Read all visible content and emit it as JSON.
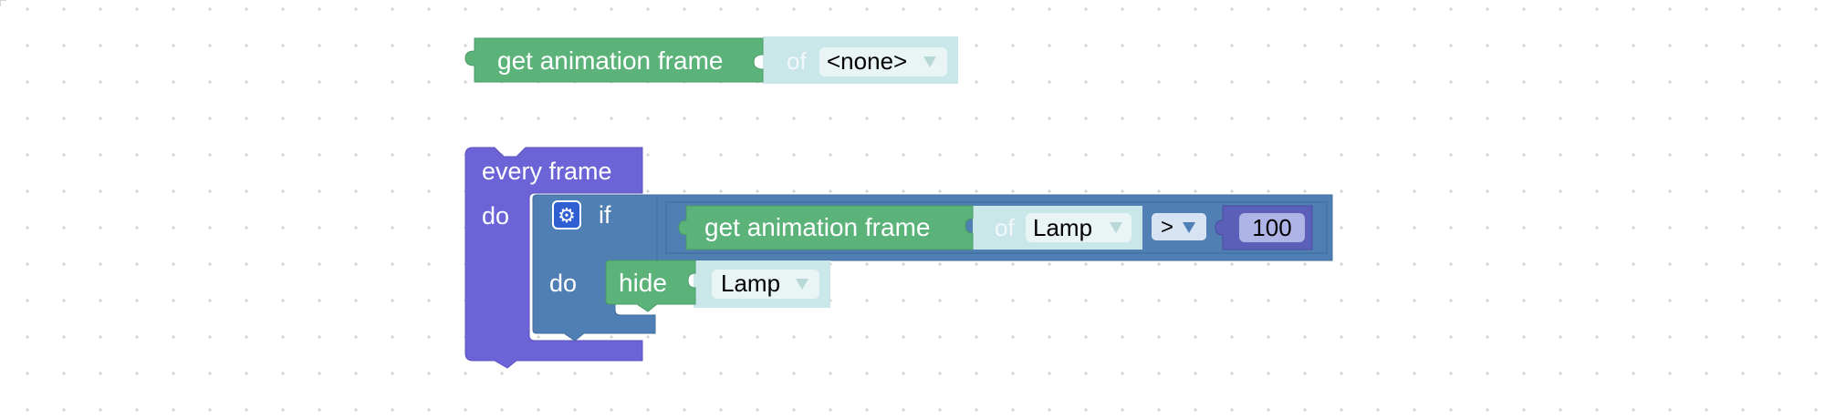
{
  "block_get_frame_1": {
    "label": "get animation frame",
    "of_label": "of",
    "object_value": "<none>"
  },
  "block_every_frame": {
    "label": "every frame",
    "do_label": "do"
  },
  "block_if": {
    "if_label": "if",
    "do_label": "do"
  },
  "block_get_frame_2": {
    "label": "get animation frame",
    "of_label": "of",
    "object_value": "Lamp"
  },
  "compare": {
    "operator": ">",
    "number_value": "100"
  },
  "block_hide": {
    "label": "hide",
    "object_value": "Lamp"
  },
  "icons": {
    "dropdown_arrow": "dropdown-arrow-icon",
    "mutator": "gear-icon"
  },
  "colors": {
    "green_block": "#5bb37a",
    "teal_socket": "#c9e6e8",
    "purple_block": "#6c63d6",
    "blue_block": "#4f7fb3",
    "number_block": "#5c5fb8",
    "grid_dot": "#c8c8c8"
  }
}
